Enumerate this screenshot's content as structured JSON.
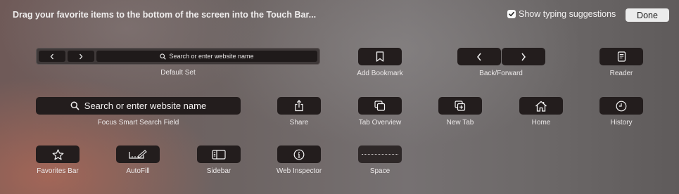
{
  "header": {
    "instruction": "Drag your favorite items to the bottom of the screen into the Touch Bar...",
    "show_typing_suggestions_label": "Show typing suggestions",
    "show_typing_suggestions_checked": true,
    "done_label": "Done"
  },
  "items": {
    "default_set": {
      "label": "Default Set",
      "search_placeholder": "Search or enter website name",
      "back_icon": "chevron-left-icon",
      "forward_icon": "chevron-right-icon"
    },
    "add_bookmark": {
      "label": "Add Bookmark",
      "icon": "bookmark-icon"
    },
    "back_forward": {
      "label": "Back/Forward",
      "icons": [
        "chevron-left-icon",
        "chevron-right-icon"
      ]
    },
    "reader": {
      "label": "Reader",
      "icon": "reader-icon"
    },
    "focus_search": {
      "label": "Focus Smart Search Field",
      "placeholder": "Search or enter website name",
      "icon": "search-icon"
    },
    "share": {
      "label": "Share",
      "icon": "share-icon"
    },
    "tab_overview": {
      "label": "Tab Overview",
      "icon": "tab-overview-icon"
    },
    "new_tab": {
      "label": "New Tab",
      "icon": "new-tab-icon"
    },
    "home": {
      "label": "Home",
      "icon": "home-icon"
    },
    "history": {
      "label": "History",
      "icon": "clock-icon"
    },
    "favorites_bar": {
      "label": "Favorites Bar",
      "icon": "star-icon"
    },
    "autofill": {
      "label": "AutoFill",
      "icon": "autofill-icon"
    },
    "sidebar": {
      "label": "Sidebar",
      "icon": "sidebar-icon"
    },
    "web_inspector": {
      "label": "Web Inspector",
      "icon": "info-icon"
    },
    "space": {
      "label": "Space",
      "icon": "space-icon"
    }
  },
  "colors": {
    "pill": "#231d1d",
    "label_text": "#ece9e9",
    "done_button": "#ececec"
  }
}
